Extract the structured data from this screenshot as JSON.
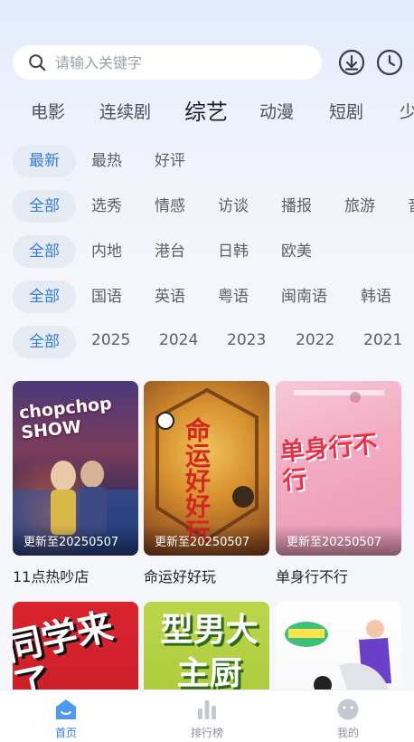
{
  "search": {
    "placeholder": "请输入关键字"
  },
  "categories": [
    "电影",
    "连续剧",
    "综艺",
    "动漫",
    "短剧",
    "少"
  ],
  "active_category": "综艺",
  "filters": {
    "sort": [
      "最新",
      "最热",
      "好评"
    ],
    "type": [
      "全部",
      "选秀",
      "情感",
      "访谈",
      "播报",
      "旅游",
      "音"
    ],
    "region": [
      "全部",
      "内地",
      "港台",
      "日韩",
      "欧美"
    ],
    "language": [
      "全部",
      "国语",
      "英语",
      "粤语",
      "闽南语",
      "韩语"
    ],
    "year": [
      "全部",
      "2025",
      "2024",
      "2023",
      "2022",
      "2021"
    ]
  },
  "cards": [
    {
      "title": "11点热吵店",
      "badge": "更新至20250507",
      "poster_text": "chopchop SHOW"
    },
    {
      "title": "命运好好玩",
      "badge": "更新至20250507",
      "poster_text": "命运好好玩"
    },
    {
      "title": "单身行不行",
      "badge": "更新至20250507",
      "poster_text": "单身行不行"
    },
    {
      "title": "",
      "badge": "",
      "poster_text": "同学来了"
    },
    {
      "title": "",
      "badge": "",
      "poster_text": "型男大主厨"
    },
    {
      "title": "",
      "badge": "",
      "poster_text": ""
    }
  ],
  "tabbar": [
    {
      "label": "首页",
      "icon": "home-icon"
    },
    {
      "label": "排行榜",
      "icon": "bar-chart-icon"
    },
    {
      "label": "我的",
      "icon": "face-icon"
    }
  ],
  "colors": {
    "accent": "#2f7de1",
    "chip_bg": "#e6ebf3"
  }
}
